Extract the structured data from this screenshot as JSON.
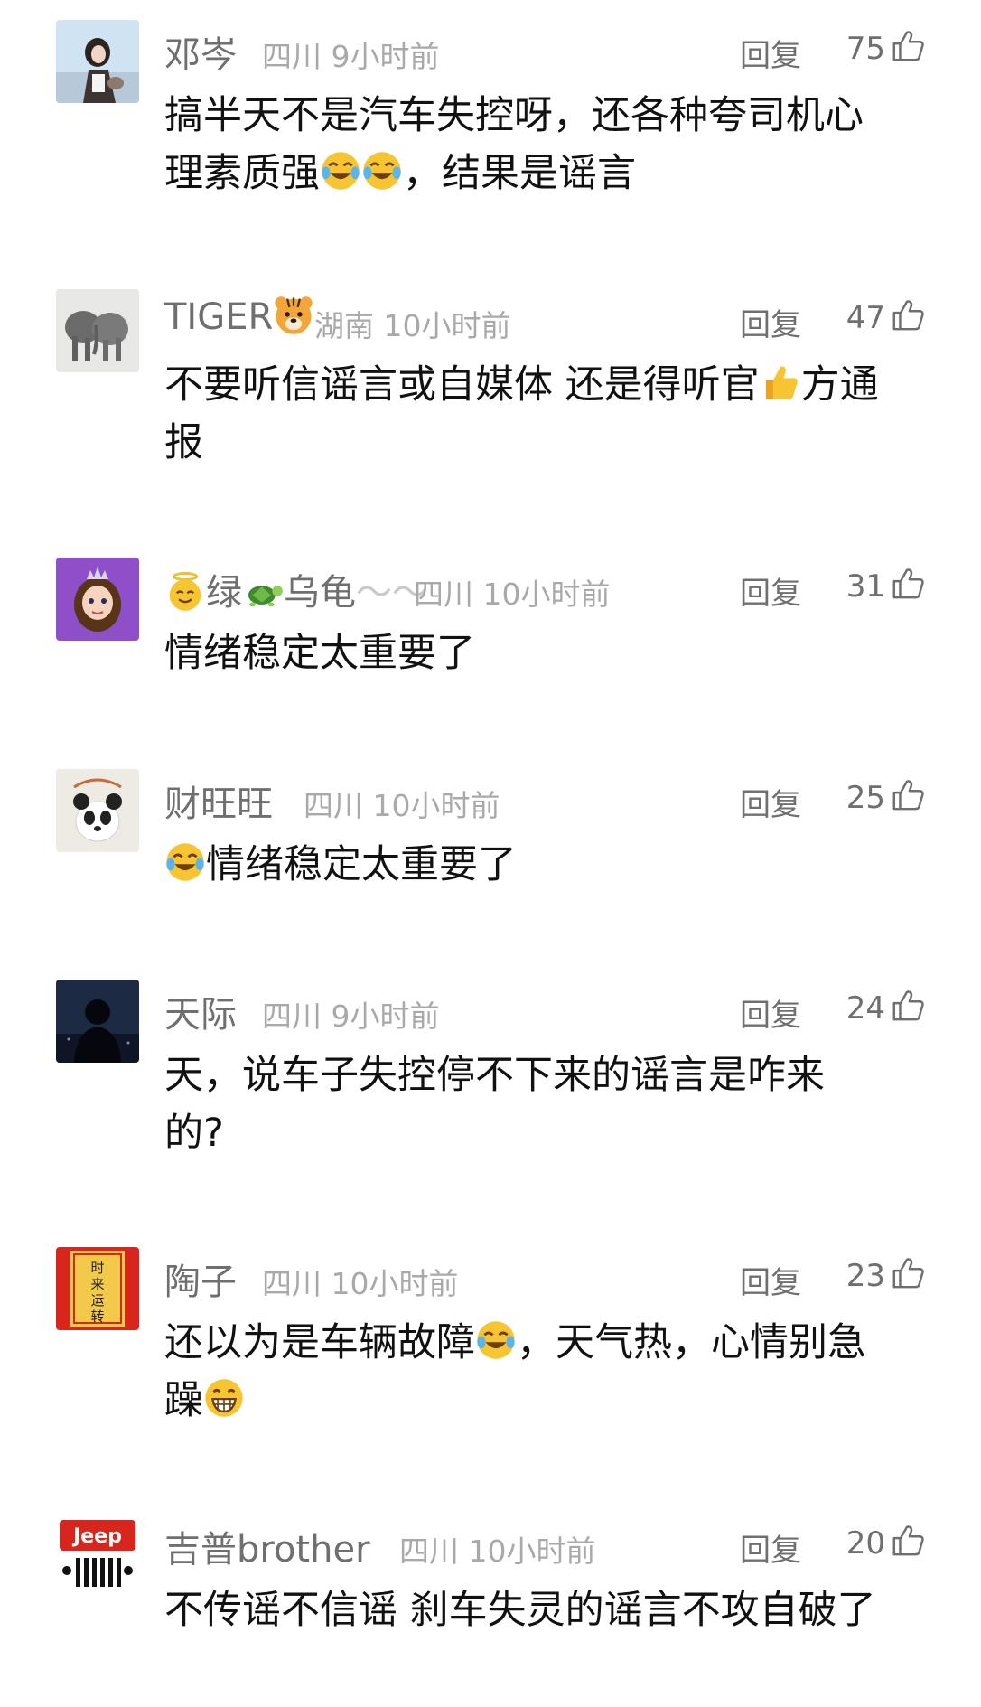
{
  "labels": {
    "reply": "回复"
  },
  "colors": {
    "username": "#6f6f6f",
    "meta": "#a9a9a9",
    "text": "#111111",
    "background": "#ffffff"
  },
  "comments": [
    {
      "username": "邓岑",
      "location": "四川",
      "time": "9小时前",
      "likes": "75",
      "avatar_icon": "girl-with-cat-avatar",
      "lines": [
        [
          "搞半天不是汽车失控呀，还各种夸司机心"
        ],
        [
          "理素质强",
          "[crying-laughing-emoji]",
          "[crying-laughing-emoji]",
          "，结果是谣言"
        ]
      ]
    },
    {
      "username": "TIGER",
      "username_emoji": "tiger-face-emoji",
      "location": "湖南",
      "time": "10小时前",
      "likes": "47",
      "avatar_icon": "elephants-avatar",
      "lines": [
        [
          "不要听信谣言或自媒体 还是得听官",
          "[thumbs-up-emoji]",
          "方通"
        ],
        [
          "报"
        ]
      ]
    },
    {
      "username_prefix_emoji": "angel-face-emoji",
      "username": "绿",
      "username_mid_emoji": "turtle-emoji",
      "username_suffix": "乌龟",
      "location": "四川",
      "time": "10小时前",
      "likes": "31",
      "avatar_icon": "princess-avatar",
      "lines": [
        [
          "情绪稳定太重要了"
        ]
      ]
    },
    {
      "username": "财旺旺",
      "location": "四川",
      "time": "10小时前",
      "likes": "25",
      "avatar_icon": "panda-avatar",
      "lines": [
        [
          "[crying-laughing-emoji]",
          "情绪稳定太重要了"
        ]
      ]
    },
    {
      "username": "天际",
      "location": "四川",
      "time": "9小时前",
      "likes": "24",
      "avatar_icon": "silhouette-avatar",
      "lines": [
        [
          "天，说车子失控停不下来的谣言是咋来"
        ],
        [
          "的?"
        ]
      ]
    },
    {
      "username": "陶子",
      "location": "四川",
      "time": "10小时前",
      "likes": "23",
      "avatar_icon": "red-banner-avatar",
      "avatar_text": "时来运转",
      "lines": [
        [
          "还以为是车辆故障",
          "[crying-laughing-emoji]",
          "，天气热，心情别急"
        ],
        [
          "躁",
          "[grinning-emoji]"
        ]
      ]
    },
    {
      "username": "吉普brother",
      "location": "四川",
      "time": "10小时前",
      "likes": "20",
      "avatar_icon": "jeep-logo-avatar",
      "avatar_text": "Jeep",
      "lines": [
        [
          "不传谣不信谣 刹车失灵的谣言不攻自破了"
        ]
      ]
    }
  ]
}
